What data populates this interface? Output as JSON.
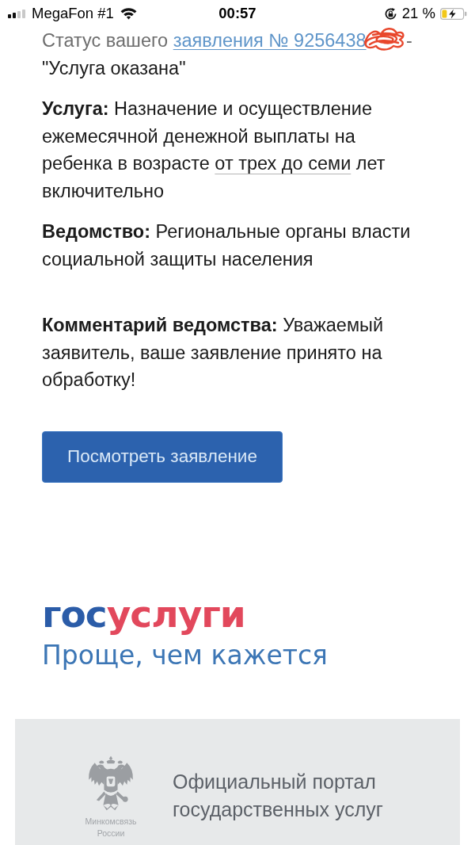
{
  "status_bar": {
    "carrier": "MegaFon #1",
    "time": "00:57",
    "battery": "21 %"
  },
  "application_status": {
    "prefix": "Статус вашего",
    "link": "заявления № 9256438",
    "suffix": "-",
    "status": "\"Услуга оказана\""
  },
  "details": [
    {
      "parts": [
        {
          "kind": "text",
          "text": "**Услуга:** Назначение и осуществление ежемесячной денежной выплаты на ребенка в возрасте"
        },
        {
          "kind": "link",
          "text": "от трех до семи"
        },
        {
          "kind": "text",
          "text": "лет включительно"
        }
      ]
    },
    {
      "parts": [
        {
          "kind": "text",
          "text": "**Ведомство:** Региональные органы власти социальной защиты населения"
        }
      ]
    }
  ],
  "comment": {
    "text": "**Комментарий ведомства:** Уважаемый заявитель, ваше заявление принято на обработку!"
  },
  "view_button": {
    "label": "Посмотреть заявление"
  },
  "logo": {
    "segments": [
      {
        "text": "гос",
        "color": "#2b5ca8"
      },
      {
        "text": "услуги",
        "color": "#e2485c"
      }
    ],
    "tagline": "Проще, чем кажется"
  },
  "footer": {
    "emblem_caption": "Минкомсвязь России",
    "title": "Официальный портал государственных услуг"
  }
}
